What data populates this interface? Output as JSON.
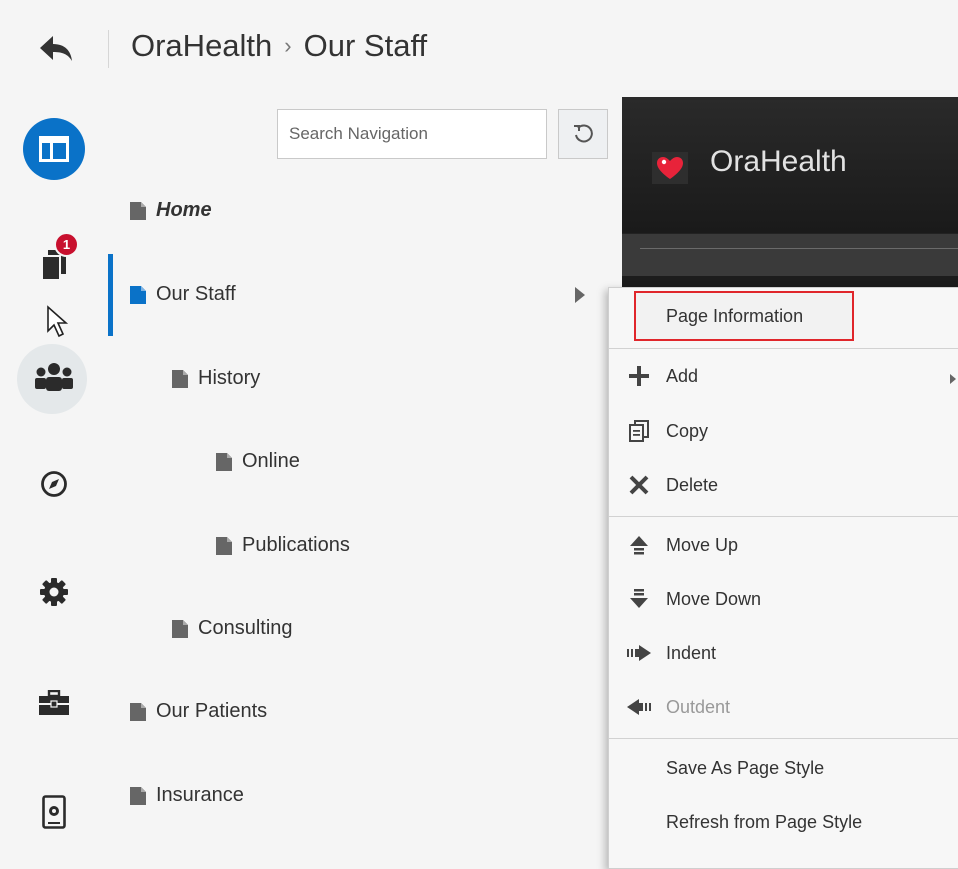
{
  "header": {
    "back_icon": "back-arrow-icon",
    "breadcrumb": [
      "OraHealth",
      "Our Staff"
    ],
    "separator": "›"
  },
  "rail": {
    "icons": [
      "page-layout-icon",
      "pages-icon",
      "people-icon",
      "compass-icon",
      "gear-icon",
      "briefcase-icon",
      "device-settings-icon"
    ],
    "pages_badge": "1"
  },
  "navigation": {
    "search_placeholder": "Search Navigation",
    "refresh_icon": "refresh-icon",
    "items": [
      {
        "label": "Home",
        "level": 0
      },
      {
        "label": "Our Staff",
        "level": 0,
        "selected": true
      },
      {
        "label": "History",
        "level": 1
      },
      {
        "label": "Online",
        "level": 2
      },
      {
        "label": "Publications",
        "level": 2
      },
      {
        "label": "Consulting",
        "level": 1
      },
      {
        "label": "Our Patients",
        "level": 0
      },
      {
        "label": "Insurance",
        "level": 0
      }
    ]
  },
  "preview": {
    "brand": "OraHealth",
    "logo_icon": "heart-logo-icon"
  },
  "context_menu": {
    "items": [
      {
        "label": "Page Information",
        "icon": "",
        "highlighted": true
      },
      {
        "label": "Add",
        "icon": "plus-icon",
        "submenu": true
      },
      {
        "label": "Copy",
        "icon": "copy-icon"
      },
      {
        "label": "Delete",
        "icon": "close-icon"
      },
      {
        "label": "Move Up",
        "icon": "move-up-icon"
      },
      {
        "label": "Move Down",
        "icon": "move-down-icon"
      },
      {
        "label": "Indent",
        "icon": "indent-icon"
      },
      {
        "label": "Outdent",
        "icon": "outdent-icon",
        "disabled": true
      },
      {
        "label": "Save As Page Style",
        "icon": ""
      },
      {
        "label": "Refresh from Page Style",
        "icon": ""
      }
    ]
  },
  "colors": {
    "accent": "#0a72c8",
    "badge": "#c8102e",
    "highlight_border": "#e0262b"
  }
}
